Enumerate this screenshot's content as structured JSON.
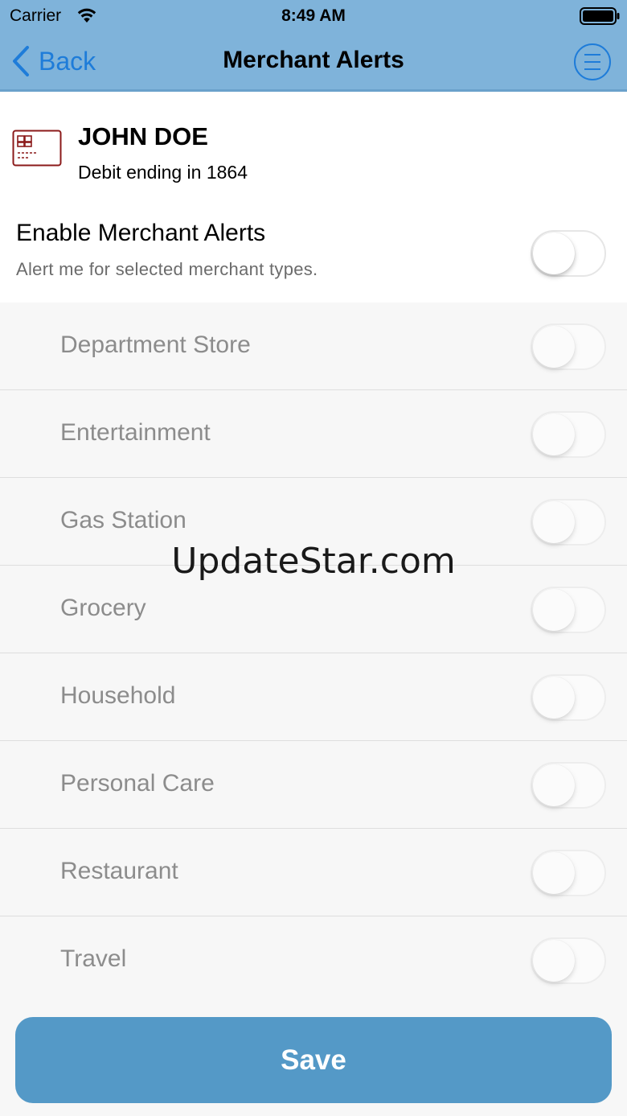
{
  "status_bar": {
    "carrier": "Carrier",
    "time": "8:49 AM",
    "wifi_icon": "wifi-icon",
    "battery_icon": "battery-icon"
  },
  "nav": {
    "back_label": "Back",
    "title": "Merchant Alerts",
    "menu_icon": "menu-list-icon"
  },
  "account": {
    "icon": "credit-card-icon",
    "name": "JOHN DOE",
    "description": "Debit ending in 1864"
  },
  "enable_alerts": {
    "title": "Enable Merchant Alerts",
    "subtitle": "Alert me for selected merchant types.",
    "enabled": false
  },
  "merchant_types": [
    {
      "label": "Department Store",
      "enabled": false
    },
    {
      "label": "Entertainment",
      "enabled": false
    },
    {
      "label": "Gas Station",
      "enabled": false
    },
    {
      "label": "Grocery",
      "enabled": false
    },
    {
      "label": "Household",
      "enabled": false
    },
    {
      "label": "Personal Care",
      "enabled": false
    },
    {
      "label": "Restaurant",
      "enabled": false
    },
    {
      "label": "Travel",
      "enabled": false
    }
  ],
  "watermark": "UpdateStar.com",
  "footer": {
    "save_label": "Save"
  },
  "colors": {
    "header_bg": "#7fb3da",
    "accent_blue": "#1e7cd9",
    "save_button": "#5499c7",
    "card_icon": "#8b1a1a"
  }
}
